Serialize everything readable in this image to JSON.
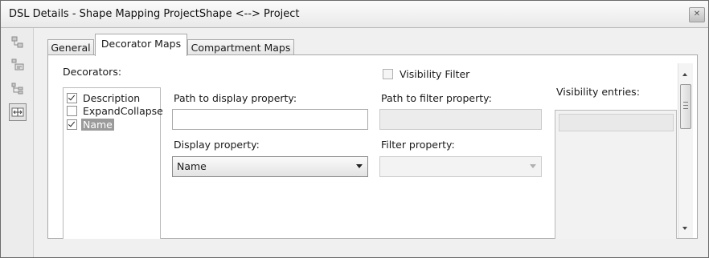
{
  "window": {
    "title": "DSL Details - Shape Mapping ProjectShape <--> Project",
    "close_glyph": "✕"
  },
  "left_toolbar": {
    "icons": [
      "tree-view-icon",
      "properties-icon",
      "hierarchy-icon",
      "decorator-maps-icon"
    ]
  },
  "tabs": [
    {
      "label": "General",
      "active": false
    },
    {
      "label": "Decorator Maps",
      "active": true
    },
    {
      "label": "Compartment Maps",
      "active": false
    }
  ],
  "decorators": {
    "label": "Decorators:",
    "items": [
      {
        "label": "Description",
        "checked": true,
        "selected": false
      },
      {
        "label": "ExpandCollapse",
        "checked": false,
        "selected": false
      },
      {
        "label": "Name",
        "checked": true,
        "selected": true
      }
    ]
  },
  "path_display": {
    "label": "Path to display property:",
    "value": ""
  },
  "display_property": {
    "label": "Display property:",
    "value": "Name"
  },
  "visibility_filter": {
    "label": "Visibility Filter",
    "checked": false
  },
  "path_filter": {
    "label": "Path to filter property:",
    "value": ""
  },
  "filter_property": {
    "label": "Filter property:",
    "value": ""
  },
  "visibility_entries": {
    "label": "Visibility entries:"
  }
}
